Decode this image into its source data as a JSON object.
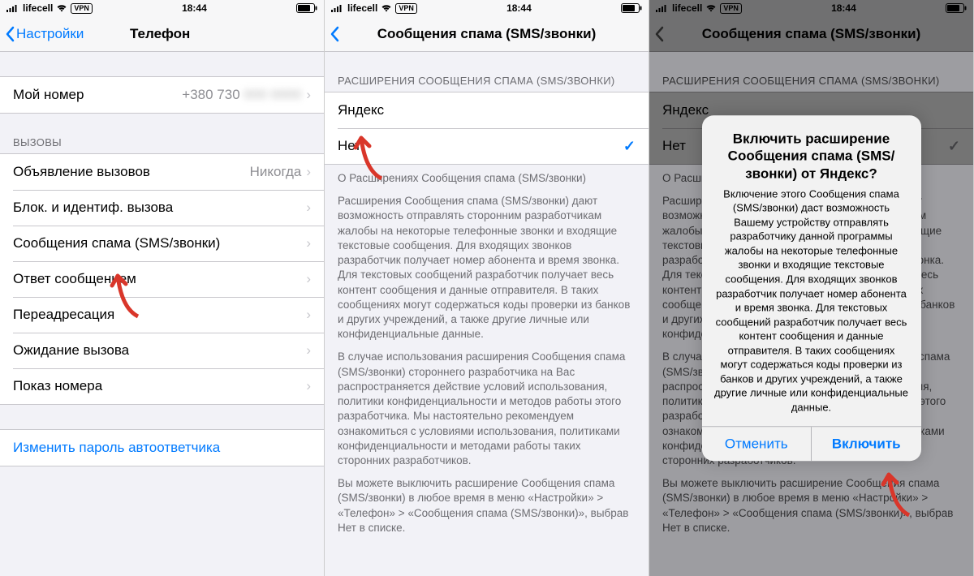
{
  "status": {
    "carrier": "lifecell",
    "vpn": "VPN",
    "time": "18:44"
  },
  "s1": {
    "back_label": "Настройки",
    "title": "Телефон",
    "my_number_label": "Мой номер",
    "my_number_value": "+380 730",
    "calls_header": "ВЫЗОВЫ",
    "rows": {
      "announce": {
        "label": "Объявление вызовов",
        "value": "Никогда"
      },
      "block": {
        "label": "Блок. и идентиф. вызова"
      },
      "spam": {
        "label": "Сообщения спама (SMS/звонки)"
      },
      "reply": {
        "label": "Ответ сообщением"
      },
      "forward": {
        "label": "Переадресация"
      },
      "waiting": {
        "label": "Ожидание вызова"
      },
      "callerid": {
        "label": "Показ номера"
      }
    },
    "voicemail_link": "Изменить пароль автоответчика"
  },
  "s2": {
    "title": "Сообщения спама (SMS/звонки)",
    "ext_header": "РАСШИРЕНИЯ СООБЩЕНИЯ СПАМА (SMS/ЗВОНКИ)",
    "option_yandex": "Яндекс",
    "option_none": "Нет",
    "about_header": "О Расширениях Сообщения спама (SMS/звонки)",
    "para1": "Расширения Сообщения спама (SMS/звонки) дают возможность отправлять сторонним разработчикам жалобы на некоторые телефонные звонки и входящие текстовые сообщения. Для входящих звонков разработчик получает номер абонента и время звонка. Для текстовых сообщений разработчик получает весь контент сообщения и данные отправителя. В таких сообщениях могут содержаться коды проверки из банков и других учреждений, а также другие личные или конфиденциальные данные.",
    "para2": "В случае использования расширения Сообщения спама (SMS/звонки) стороннего разработчика на Вас распространяется действие условий использования, политики конфиденциальности и методов работы этого разработчика. Мы настоятельно рекомендуем ознакомиться с условиями использования, политиками конфиденциальности и методами работы таких сторонних разработчиков.",
    "para3": "Вы можете выключить расширение Сообщения спама (SMS/звонки) в любое время в меню «Настройки» > «Телефон» > «Сообщения спама (SMS/звонки)», выбрав Нет в списке."
  },
  "s3": {
    "alert_title": "Включить расширение Сообщения спама (SMS/звонки) от Яндекс?",
    "alert_body": "Включение этого Сообщения спама (SMS/звонки) даст возможность Вашему устройству отправлять разработчику данной программы жалобы на некоторые телефонные звонки и входящие текстовые сообщения. Для входящих звонков разработчик получает номер абонента и время звонка. Для текстовых сообщений разработчик получает весь контент сообщения и данные отправителя. В таких сообщениях могут содержаться коды проверки из банков и других учреждений, а также другие личные или конфиденциальные данные.",
    "cancel": "Отменить",
    "enable": "Включить"
  }
}
